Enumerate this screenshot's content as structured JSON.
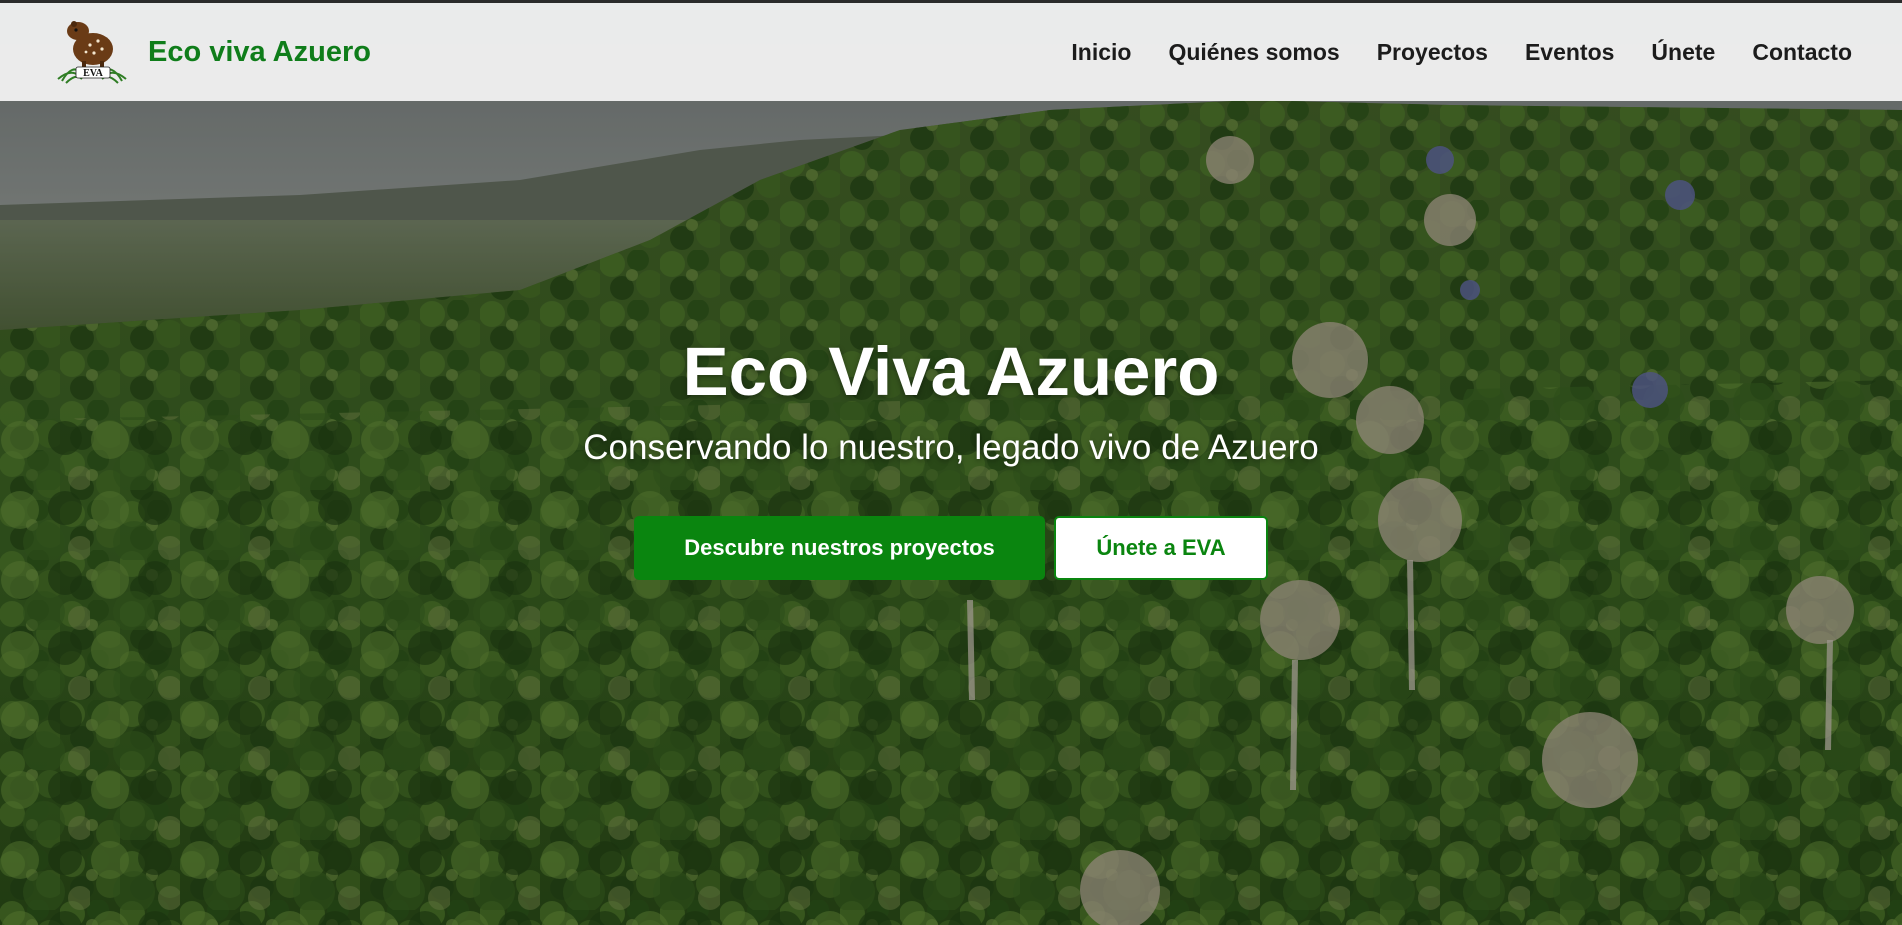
{
  "navbar": {
    "brand_name": "Eco viva Azuero",
    "logo_text": "EVA",
    "links": [
      {
        "label": "Inicio"
      },
      {
        "label": "Quiénes somos"
      },
      {
        "label": "Proyectos"
      },
      {
        "label": "Eventos"
      },
      {
        "label": "Únete"
      },
      {
        "label": "Contacto"
      }
    ]
  },
  "hero": {
    "title": "Eco Viva Azuero",
    "subtitle": "Conservando lo nuestro, legado vivo de Azuero",
    "primary_button": "Descubre nuestros proyectos",
    "secondary_button": "Únete a EVA"
  },
  "colors": {
    "brand_green": "#0f7d1a",
    "button_green": "#0a850f",
    "nav_text": "#1c1c1c",
    "navbar_bg": "#f5f5f5"
  },
  "icons": {
    "logo": "capybara-logo-icon"
  }
}
